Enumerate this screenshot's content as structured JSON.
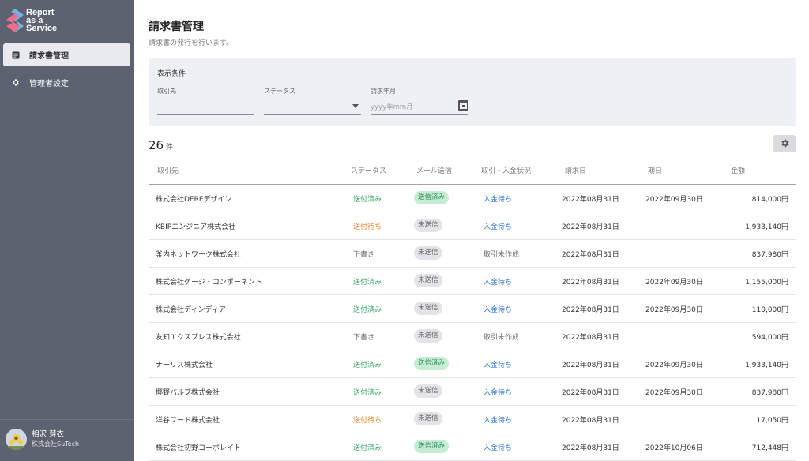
{
  "app": {
    "logo_lines": [
      "Report",
      "as a",
      "Service"
    ]
  },
  "sidebar": {
    "items": [
      {
        "label": "請求書管理",
        "icon": "document-icon",
        "active": true
      },
      {
        "label": "管理者設定",
        "icon": "gear-icon",
        "active": false
      }
    ],
    "user": {
      "name": "相沢 芽衣",
      "company": "株式会社SuTech"
    }
  },
  "page": {
    "title": "請求書管理",
    "subtitle": "請求書の発行を行います。"
  },
  "filter": {
    "title": "表示条件",
    "client_label": "取引先",
    "client_value": "",
    "status_label": "ステータス",
    "status_value": "",
    "month_label": "請求年月",
    "month_placeholder": "yyyy年mm月"
  },
  "result": {
    "count": "26",
    "unit": "件"
  },
  "table": {
    "columns": [
      "取引先",
      "ステータス",
      "メール送信",
      "取引・入金状況",
      "請求日",
      "期日",
      "金額"
    ],
    "rows": [
      {
        "client": "株式会社DEREデザイン",
        "status": "送付済み",
        "status_type": "sent",
        "mail": "送信済み",
        "mail_type": "sent",
        "payment": "入金待ち",
        "payment_type": "wait",
        "invoice_date": "2022年08月31日",
        "due_date": "2022年09月30日",
        "amount": "814,000円"
      },
      {
        "client": "KBIPエンジニア株式会社",
        "status": "送付待ち",
        "status_type": "wait",
        "mail": "未送信",
        "mail_type": "unsent",
        "payment": "入金待ち",
        "payment_type": "wait",
        "invoice_date": "2022年08月31日",
        "due_date": "",
        "amount": "1,933,140円"
      },
      {
        "client": "釜内ネットワーク株式会社",
        "status": "下書き",
        "status_type": "draft",
        "mail": "未送信",
        "mail_type": "unsent",
        "payment": "取引未作成",
        "payment_type": "none",
        "invoice_date": "2022年08月31日",
        "due_date": "",
        "amount": "837,980円"
      },
      {
        "client": "株式会社ゲージ・コンポーネント",
        "status": "送付済み",
        "status_type": "sent",
        "mail": "未送信",
        "mail_type": "unsent",
        "payment": "入金待ち",
        "payment_type": "wait",
        "invoice_date": "2022年08月31日",
        "due_date": "2022年09月30日",
        "amount": "1,155,000円"
      },
      {
        "client": "株式会社ディンディア",
        "status": "送付済み",
        "status_type": "sent",
        "mail": "未送信",
        "mail_type": "unsent",
        "payment": "入金待ち",
        "payment_type": "wait",
        "invoice_date": "2022年08月31日",
        "due_date": "2022年09月30日",
        "amount": "110,000円"
      },
      {
        "client": "友知エクスプレス株式会社",
        "status": "下書き",
        "status_type": "draft",
        "mail": "未送信",
        "mail_type": "unsent",
        "payment": "取引未作成",
        "payment_type": "none",
        "invoice_date": "2022年08月31日",
        "due_date": "",
        "amount": "594,000円"
      },
      {
        "client": "ナーリス株式会社",
        "status": "送付済み",
        "status_type": "sent",
        "mail": "送信済み",
        "mail_type": "sent",
        "payment": "入金待ち",
        "payment_type": "wait",
        "invoice_date": "2022年08月31日",
        "due_date": "2022年09月30日",
        "amount": "1,933,140円"
      },
      {
        "client": "椰野バルブ株式会社",
        "status": "送付済み",
        "status_type": "sent",
        "mail": "未送信",
        "mail_type": "unsent",
        "payment": "入金待ち",
        "payment_type": "wait",
        "invoice_date": "2022年08月31日",
        "due_date": "2022年09月30日",
        "amount": "837,980円"
      },
      {
        "client": "洋谷フード株式会社",
        "status": "送付待ち",
        "status_type": "wait",
        "mail": "未送信",
        "mail_type": "unsent",
        "payment": "入金待ち",
        "payment_type": "wait",
        "invoice_date": "2022年08月31日",
        "due_date": "",
        "amount": "17,050円"
      },
      {
        "client": "株式会社初野コーポレイト",
        "status": "送付済み",
        "status_type": "sent",
        "mail": "送信済み",
        "mail_type": "sent",
        "payment": "入金待ち",
        "payment_type": "wait",
        "invoice_date": "2022年08月31日",
        "due_date": "2022年10月06日",
        "amount": "712,448円"
      }
    ]
  },
  "colors": {
    "sidebar_bg": "#5c6270",
    "status_sent": "#3aa86b",
    "status_wait": "#ef8a3b",
    "link_blue": "#2f7ad8",
    "pill_sent_bg": "#c6ecd6"
  }
}
